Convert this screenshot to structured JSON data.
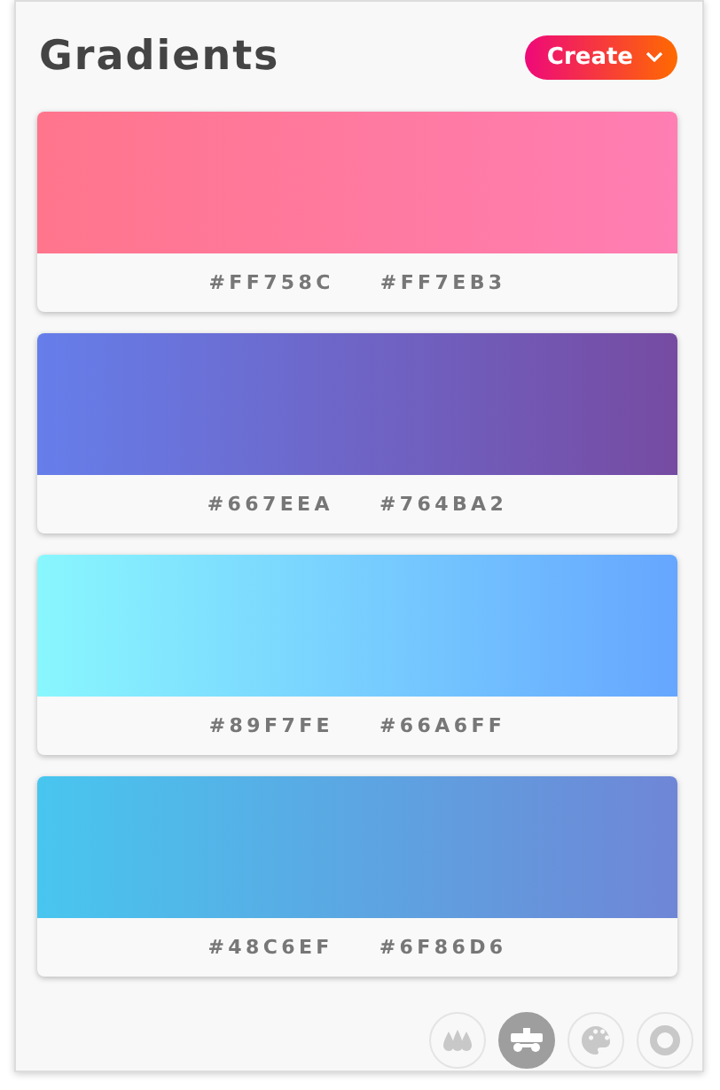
{
  "title": "Gradients",
  "create_button": {
    "label": "Create"
  },
  "gradients": [
    {
      "stops": [
        {
          "hex": "#FF758C",
          "color": "#ff758c"
        },
        {
          "hex": "#FF7EB3",
          "color": "#ff7eb3"
        }
      ]
    },
    {
      "stops": [
        {
          "hex": "#667EEA",
          "color": "#667eea"
        },
        {
          "hex": "#764BA2",
          "color": "#764ba2"
        }
      ]
    },
    {
      "stops": [
        {
          "hex": "#89F7FE",
          "color": "#89f7fe"
        },
        {
          "hex": "#66A6FF",
          "color": "#66a6ff"
        }
      ]
    },
    {
      "stops": [
        {
          "hex": "#48C6EF",
          "color": "#48c6ef"
        },
        {
          "hex": "#6F86D6",
          "color": "#6f86d6"
        }
      ]
    }
  ],
  "toolbar": [
    {
      "kind": "drops",
      "selected": false
    },
    {
      "kind": "vehicle",
      "selected": true
    },
    {
      "kind": "palette",
      "selected": false
    },
    {
      "kind": "ring",
      "selected": false
    }
  ]
}
